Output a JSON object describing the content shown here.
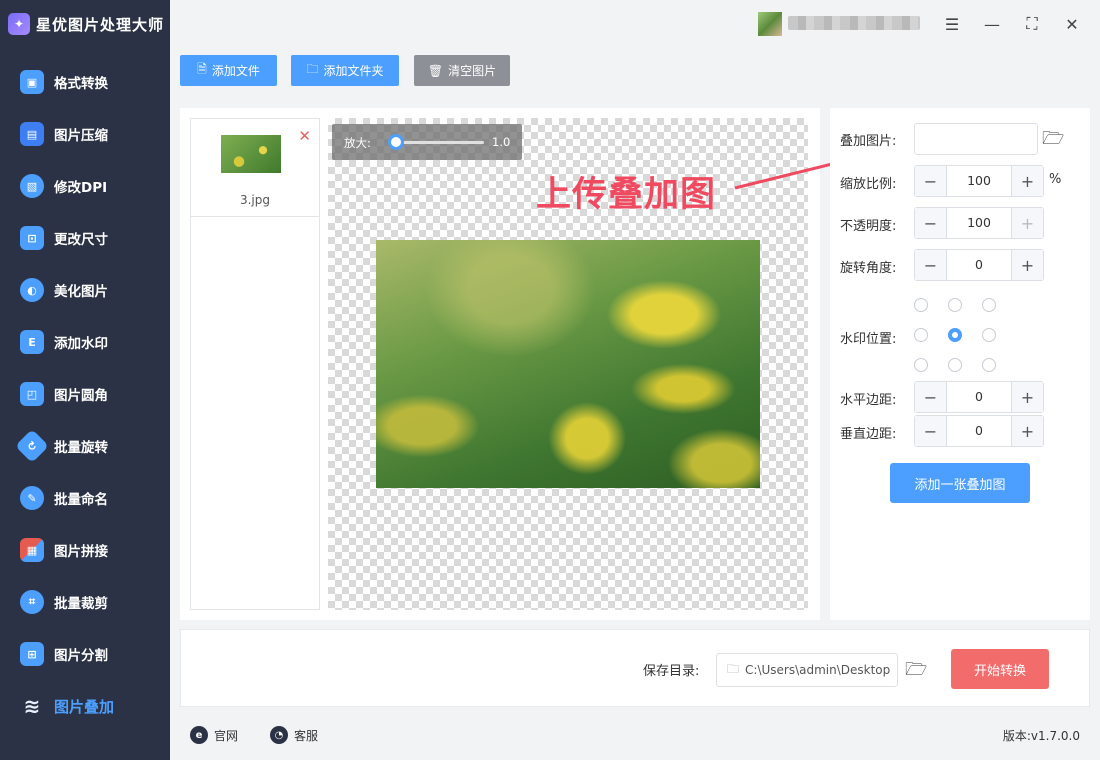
{
  "app": {
    "title": "星优图片处理大师"
  },
  "sidebar": {
    "items": [
      {
        "label": "格式转换",
        "icon": "image-convert-icon",
        "color": "#4c9ffe"
      },
      {
        "label": "图片压缩",
        "icon": "image-compress-icon",
        "color": "#3d7ff2"
      },
      {
        "label": "修改DPI",
        "icon": "dpi-icon",
        "color": "#4c9ffe"
      },
      {
        "label": "更改尺寸",
        "icon": "resize-icon",
        "color": "#4c9ffe"
      },
      {
        "label": "美化图片",
        "icon": "beautify-icon",
        "color": "#4c9ffe"
      },
      {
        "label": "添加水印",
        "icon": "watermark-icon",
        "color": "#4c9ffe"
      },
      {
        "label": "图片圆角",
        "icon": "round-corner-icon",
        "color": "#4c9ffe"
      },
      {
        "label": "批量旋转",
        "icon": "rotate-icon",
        "color": "#4c9ffe"
      },
      {
        "label": "批量命名",
        "icon": "rename-icon",
        "color": "#4c9ffe"
      },
      {
        "label": "图片拼接",
        "icon": "stitch-icon",
        "color": "#e65b4f"
      },
      {
        "label": "批量裁剪",
        "icon": "crop-icon",
        "color": "#4c9ffe"
      },
      {
        "label": "图片分割",
        "icon": "split-icon",
        "color": "#4c9ffe"
      },
      {
        "label": "图片叠加",
        "icon": "layers-icon",
        "color": "#4c9ffe",
        "active": true
      }
    ]
  },
  "toolbar": {
    "add_file": "添加文件",
    "add_folder": "添加文件夹",
    "clear_images": "清空图片"
  },
  "file_list": {
    "items": [
      {
        "name": "3.jpg"
      }
    ]
  },
  "preview": {
    "zoom_label": "放大:",
    "zoom_value": "1.0",
    "zoom_level": 0.0
  },
  "annotation": {
    "text": "上传叠加图",
    "color": "#f04a60"
  },
  "settings": {
    "overlay_image_label": "叠加图片:",
    "overlay_image_value": "",
    "scale_label": "缩放比例:",
    "scale_value": "100",
    "scale_unit": "%",
    "opacity_label": "不透明度:",
    "opacity_value": "100",
    "rotation_label": "旋转角度:",
    "rotation_value": "0",
    "position_label": "水印位置:",
    "position_selected": "middle-center",
    "h_margin_label": "水平边距:",
    "h_margin_value": "0",
    "v_margin_label": "垂直边距:",
    "v_margin_value": "0",
    "add_overlay_button": "添加一张叠加图"
  },
  "bottom": {
    "save_dir_label": "保存目录:",
    "save_dir_value": "C:\\Users\\admin\\Desktop",
    "start_button": "开始转换"
  },
  "footer": {
    "website": "官网",
    "support": "客服",
    "version": "版本:v1.7.0.0"
  },
  "colors": {
    "primary": "#4c9ffe",
    "danger": "#f36c6c",
    "sidebar_bg": "#2b3245"
  }
}
